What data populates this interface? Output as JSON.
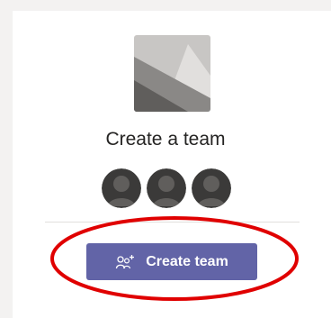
{
  "card": {
    "title": "Create a team",
    "image_icon": "image-placeholder-icon",
    "avatars": [
      {
        "icon": "person-icon"
      },
      {
        "icon": "person-icon"
      },
      {
        "icon": "person-icon"
      }
    ],
    "button": {
      "label": "Create team",
      "icon": "people-add-icon"
    }
  },
  "colors": {
    "background": "#f3f2f1",
    "card": "#ffffff",
    "accent": "#6264a7",
    "annotation": "#e00000",
    "avatar": "#3b3a39"
  }
}
